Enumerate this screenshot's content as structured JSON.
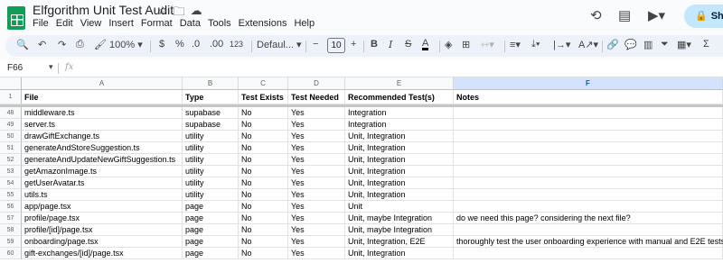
{
  "app": {
    "title": "Elfgorithm Unit Test Audit",
    "menus": [
      "File",
      "Edit",
      "View",
      "Insert",
      "Format",
      "Data",
      "Tools",
      "Extensions",
      "Help"
    ],
    "share_label": "Sha"
  },
  "toolbar": {
    "zoom": "100%",
    "currency": "$",
    "percent": "%",
    "dec_decrease": ".0",
    "dec_increase": ".00",
    "number_format": "123",
    "font": "Defaul...",
    "font_size": "10",
    "bold": "B",
    "italic": "I",
    "strike": "S",
    "text_color": "A",
    "sigma": "Σ"
  },
  "formula_bar": {
    "cell_ref": "F66",
    "fx": "fx"
  },
  "sheet": {
    "columns": [
      "A",
      "B",
      "C",
      "D",
      "E",
      "F"
    ],
    "selected_column": "F",
    "header_row_number": "1",
    "headers": [
      "File",
      "Type",
      "Test Exists",
      "Test Needed",
      "Recommended Test(s)",
      "Notes"
    ],
    "rows": [
      {
        "num": "48",
        "cells": [
          "middleware.ts",
          "supabase",
          "No",
          "Yes",
          "Integration",
          ""
        ]
      },
      {
        "num": "49",
        "cells": [
          "server.ts",
          "supabase",
          "No",
          "Yes",
          "Integration",
          ""
        ]
      },
      {
        "num": "50",
        "cells": [
          "drawGiftExchange.ts",
          "utility",
          "No",
          "Yes",
          "Unit, Integration",
          ""
        ]
      },
      {
        "num": "51",
        "cells": [
          "generateAndStoreSuggestion.ts",
          "utility",
          "No",
          "Yes",
          "Unit, Integration",
          ""
        ]
      },
      {
        "num": "52",
        "cells": [
          "generateAndUpdateNewGiftSuggestion.ts",
          "utility",
          "No",
          "Yes",
          "Unit, Integration",
          ""
        ]
      },
      {
        "num": "53",
        "cells": [
          "getAmazonImage.ts",
          "utility",
          "No",
          "Yes",
          "Unit, Integration",
          ""
        ]
      },
      {
        "num": "54",
        "cells": [
          "getUserAvatar.ts",
          "utility",
          "No",
          "Yes",
          "Unit, Integration",
          ""
        ]
      },
      {
        "num": "55",
        "cells": [
          "utils.ts",
          "utility",
          "No",
          "Yes",
          "Unit, Integration",
          ""
        ]
      },
      {
        "num": "56",
        "cells": [
          "app/page.tsx",
          "page",
          "No",
          "Yes",
          "Unit",
          ""
        ]
      },
      {
        "num": "57",
        "cells": [
          "profile/page.tsx",
          "page",
          "No",
          "Yes",
          "Unit, maybe Integration",
          "do we need this page? considering the next file?"
        ]
      },
      {
        "num": "58",
        "cells": [
          "profile/[id]/page.tsx",
          "page",
          "No",
          "Yes",
          "Unit, maybe Integration",
          ""
        ]
      },
      {
        "num": "59",
        "cells": [
          "onboarding/page.tsx",
          "page",
          "No",
          "Yes",
          "Unit, Integration, E2E",
          "thoroughly test the user onboarding experience with manual and E2E tests"
        ]
      },
      {
        "num": "60",
        "cells": [
          "gift-exchanges/[id]/page.tsx",
          "page",
          "No",
          "Yes",
          "Unit, Integration",
          ""
        ]
      }
    ]
  },
  "colors": {
    "accent": "#0b57d0",
    "sheets_green": "#0f9d58",
    "share_bg": "#c2e7ff",
    "toolbar_bg": "#edf2fa"
  }
}
